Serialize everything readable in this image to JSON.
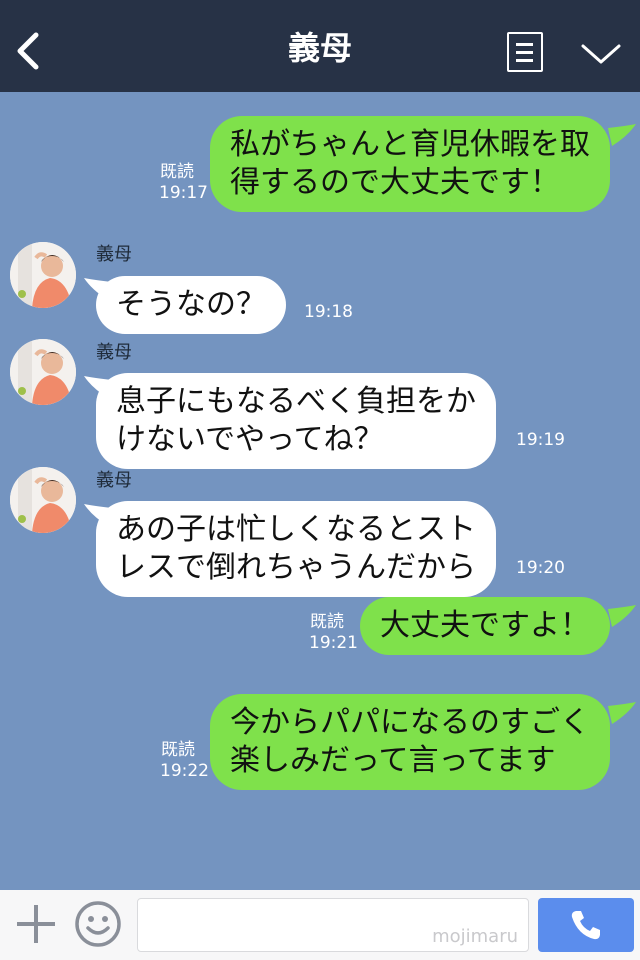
{
  "header": {
    "title": "義母",
    "back_icon": "chevron-left-icon",
    "menu_icon": "note-menu-icon",
    "collapse_icon": "chevron-down-icon"
  },
  "colors": {
    "header_bg": "#273246",
    "chat_bg": "#7494c0",
    "my_bubble": "#7fe14b",
    "their_bubble": "#ffffff",
    "call_button": "#5b8ded"
  },
  "messages": [
    {
      "from": "me",
      "text": "私がちゃんと育児休暇を取\n得するので大丈夫です！",
      "read": "既読",
      "time": "19:17"
    },
    {
      "from": "them",
      "sender": "義母",
      "text": "そうなの？",
      "time": "19:18"
    },
    {
      "from": "them",
      "sender": "義母",
      "text": "息子にもなるべく負担をか\nけないでやってね？",
      "time": "19:19"
    },
    {
      "from": "them",
      "sender": "義母",
      "text": "あの子は忙しくなるとスト\nレスで倒れちゃうんだから",
      "time": "19:20"
    },
    {
      "from": "me",
      "text": "大丈夫ですよ！",
      "read": "既読",
      "time": "19:21"
    },
    {
      "from": "me",
      "text": "今からパパになるのすごく\n楽しみだって言ってます",
      "read": "既読",
      "time": "19:22"
    }
  ],
  "input_bar": {
    "plus_icon": "plus-icon",
    "emoji_icon": "emoji-icon",
    "watermark": "mojimaru",
    "call_icon": "phone-icon"
  }
}
